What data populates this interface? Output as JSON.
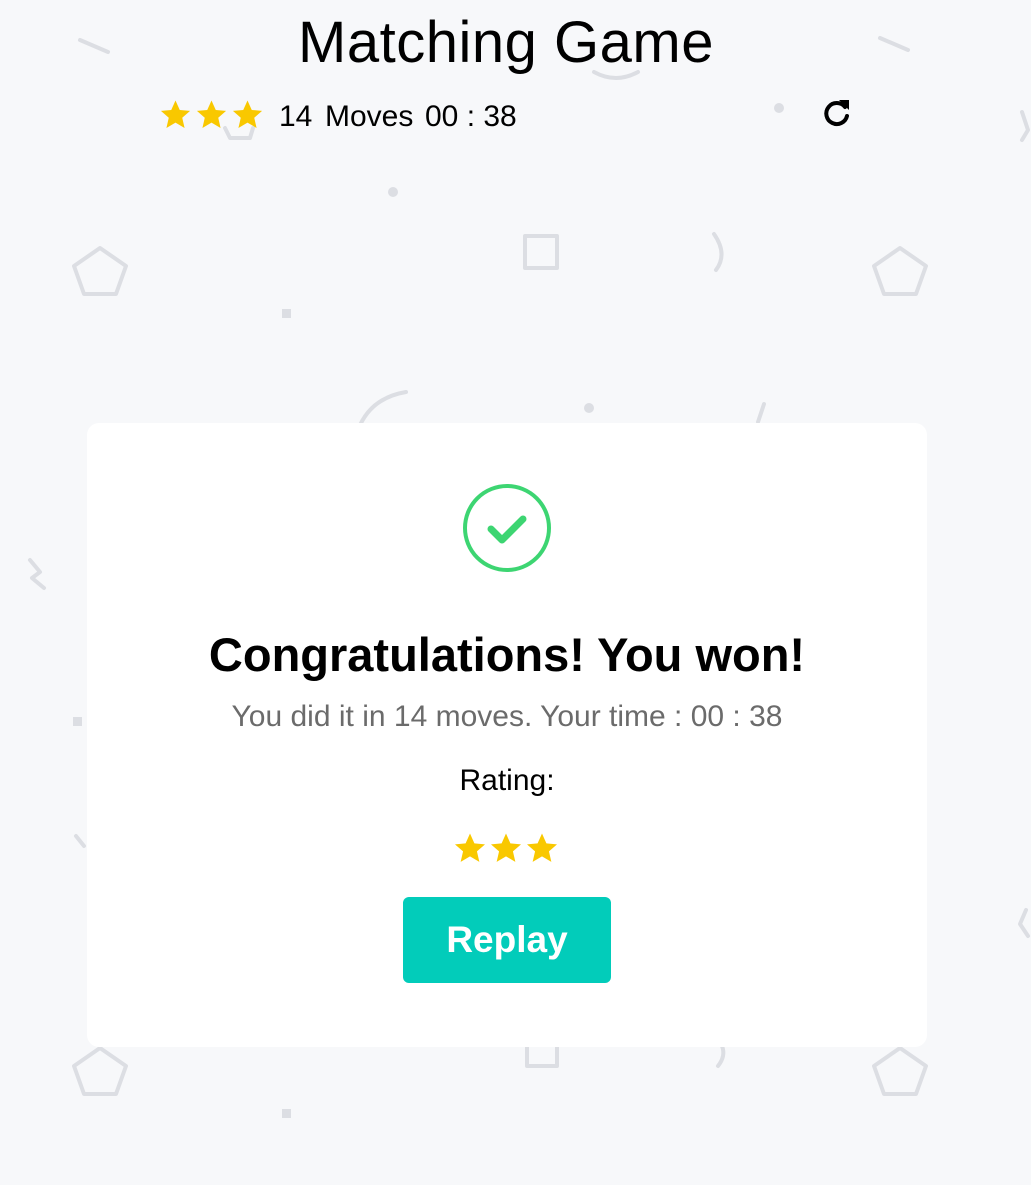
{
  "header": {
    "title": "Matching Game"
  },
  "score_panel": {
    "stars_earned": 3,
    "stars_total": 3,
    "moves_count": "14",
    "moves_label": "Moves",
    "timer": "00 : 38"
  },
  "modal": {
    "heading": "Congratulations! You won!",
    "summary": "You did it in 14 moves. Your time : 00 : 38",
    "rating_label": "Rating:",
    "rating_stars": 3,
    "replay_label": "Replay"
  },
  "colors": {
    "star": "#f9c800",
    "check": "#3dd572",
    "replay_button": "#02ccba",
    "background": "#f7f8fa"
  },
  "icons": {
    "restart": "restart-icon",
    "check": "check-circle-icon",
    "star": "star-icon"
  }
}
